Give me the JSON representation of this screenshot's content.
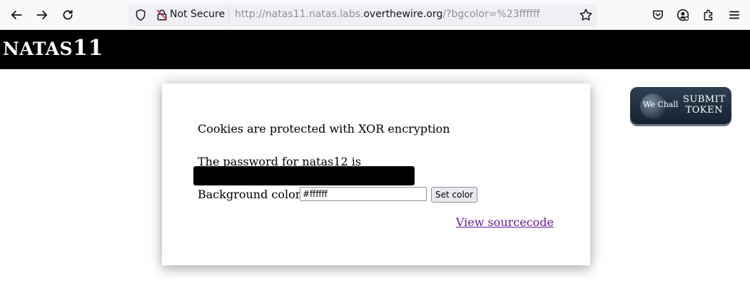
{
  "browser": {
    "security_label": "Not Secure",
    "url_prefix": "http://natas11.natas.labs.",
    "url_host": "overthewire.org",
    "url_suffix": "/?bgcolor=%23ffffff",
    "icons": [
      "back-icon",
      "forward-icon",
      "reload-icon",
      "shield-icon",
      "broken-lock-icon",
      "star-icon",
      "pocket-icon",
      "account-icon",
      "extensions-icon",
      "menu-icon"
    ]
  },
  "header": {
    "title_prefix": "NATAS",
    "title_number": "11"
  },
  "content": {
    "line1": "Cookies are protected with XOR encryption",
    "line2": "The password for natas12 is",
    "bg_label": "Background color:",
    "bg_value": "#ffffff",
    "set_button": "Set color",
    "source_link": "View sourcecode"
  },
  "badge": {
    "logo_text": "We Chall",
    "submit_line1": "SUBMIT",
    "submit_line2": "TOKEN"
  }
}
